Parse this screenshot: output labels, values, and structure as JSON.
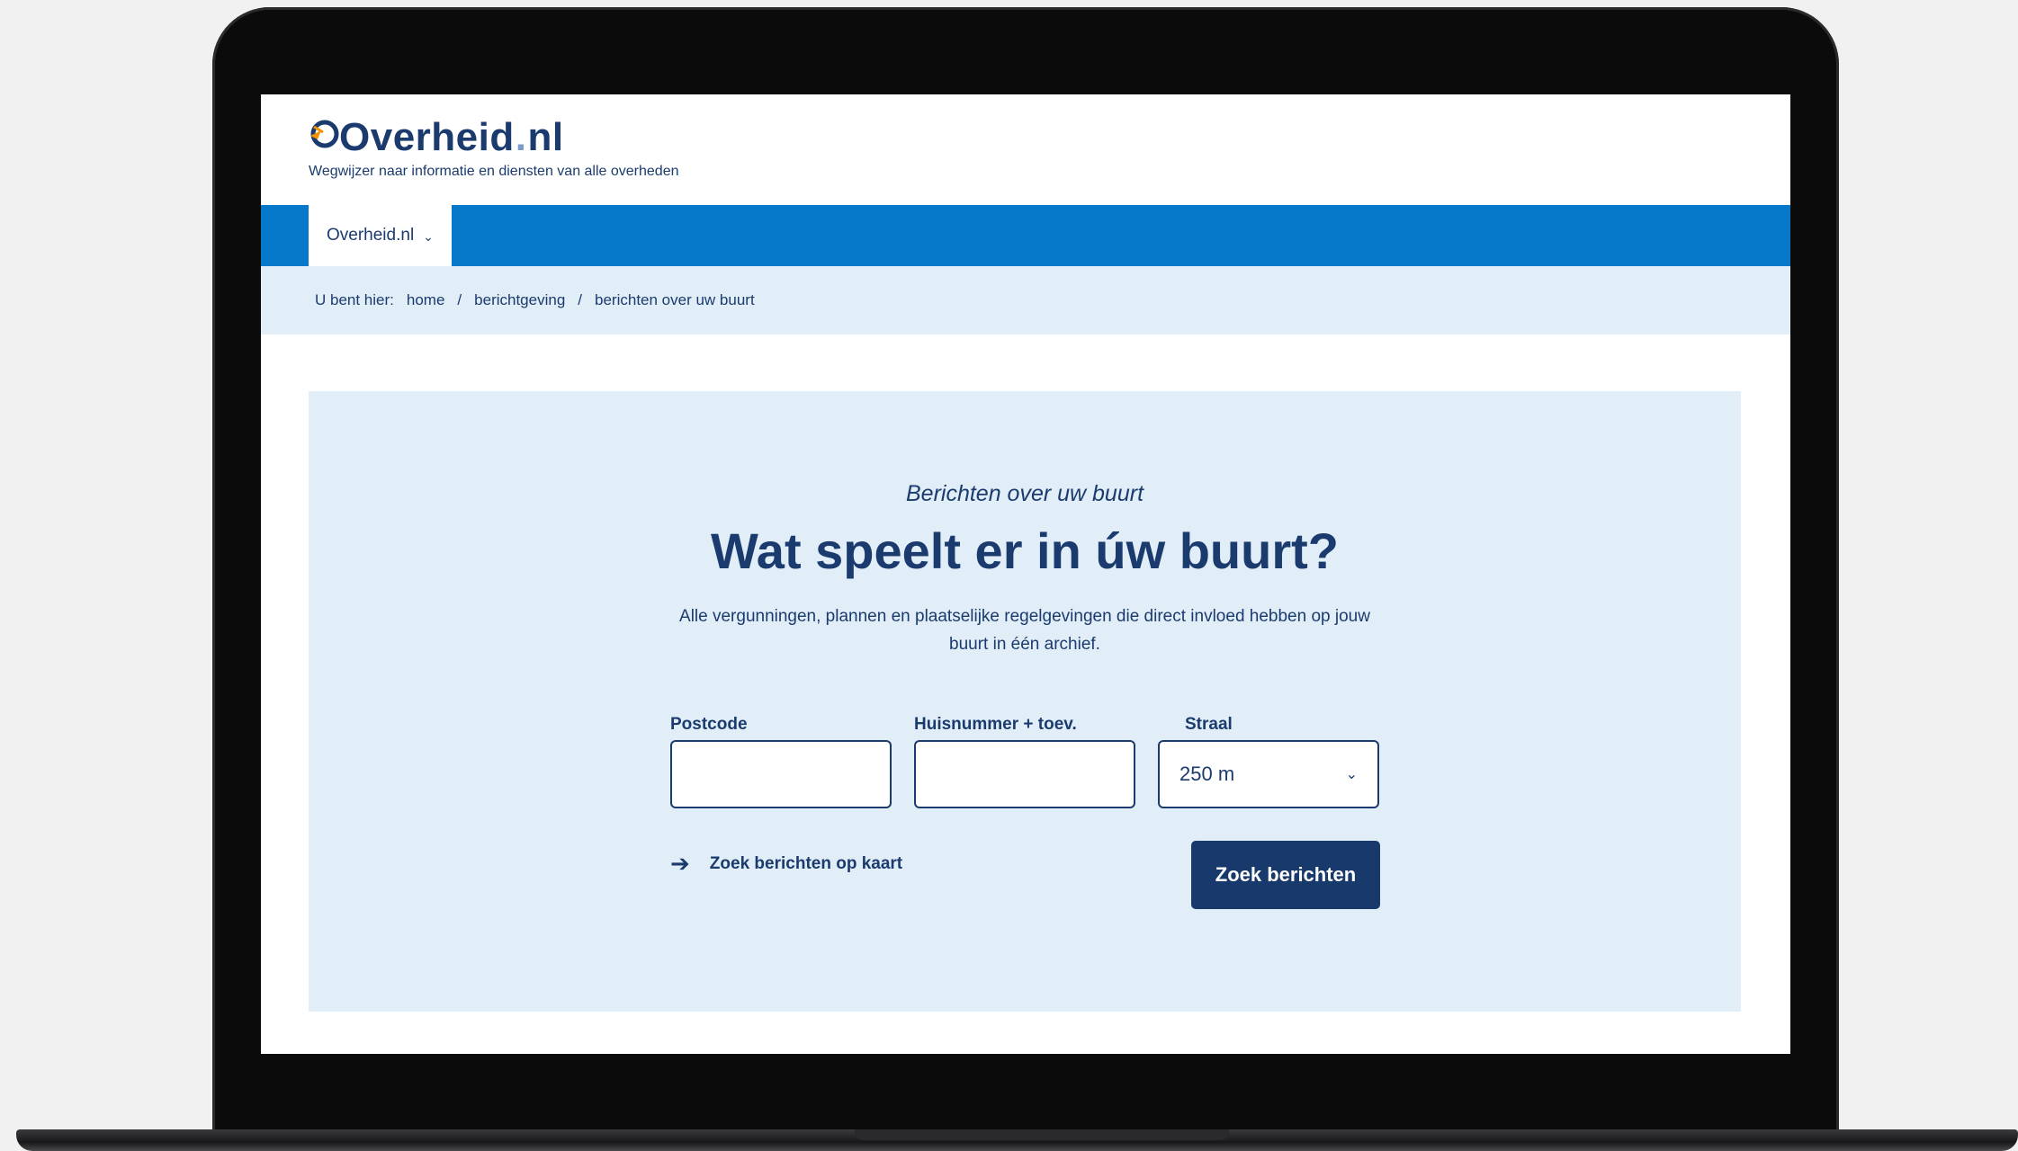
{
  "header": {
    "logo_text": "Overheid",
    "logo_dot": ".",
    "logo_tld": "nl",
    "logo_icon": "sunrise-o-icon",
    "tagline": "Wegwijzer naar informatie en diensten van alle overheden"
  },
  "nav": {
    "tab_label": "Overheid.nl",
    "tab_icon": "chevron-down-icon"
  },
  "breadcrumb": {
    "prefix": "U bent hier:",
    "items": [
      "home",
      "berichtgeving",
      "berichten over uw buurt"
    ],
    "separator": "/"
  },
  "hero": {
    "eyebrow": "Berichten over uw buurt",
    "title": "Wat speelt er in úw buurt?",
    "lede": "Alle vergunningen, plannen en plaatselijke regelgevingen die direct invloed hebben op jouw buurt in één archief."
  },
  "form": {
    "postcode_label": "Postcode",
    "postcode_value": "",
    "huisnummer_label": "Huisnummer + toev.",
    "huisnummer_value": "",
    "straal_label": "Straal",
    "straal_value": "250 m",
    "map_link_label": "Zoek berichten op kaart",
    "map_link_icon": "arrow-right-icon",
    "submit_label": "Zoek berichten"
  },
  "colors": {
    "brand_dark": "#1b3b6f",
    "nav_blue": "#0678c9",
    "light_panel": "#e1eef8",
    "button": "#17396b",
    "logo_accent": "#f39200"
  }
}
